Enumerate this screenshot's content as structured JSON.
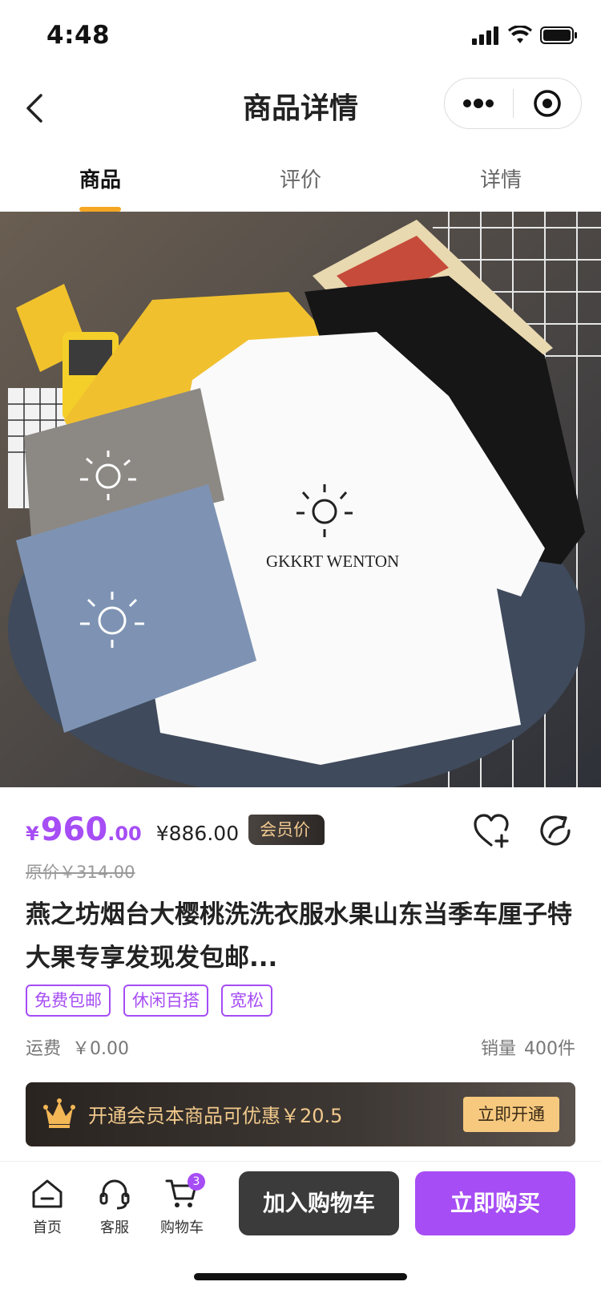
{
  "status_bar": {
    "time": "4:48"
  },
  "nav": {
    "title": "商品详情"
  },
  "tabs": [
    {
      "label": "商品",
      "active": true
    },
    {
      "label": "评价",
      "active": false
    },
    {
      "label": "详情",
      "active": false
    }
  ],
  "hero": {
    "shirt_print": "GKKRT WENTON"
  },
  "price": {
    "currency": "¥",
    "integer": "960",
    "decimal": ".00",
    "member_price": "¥886.00",
    "member_badge": "会员价",
    "original": "原价￥314.00"
  },
  "product": {
    "title": "燕之坊烟台大樱桃洗洗衣服水果山东当季车厘子特大果专享发现发包邮..."
  },
  "tags": [
    "免费包邮",
    "休闲百搭",
    "宽松"
  ],
  "freight": {
    "label": "运费",
    "value": "￥0.00"
  },
  "sales": {
    "label": "销量",
    "value": "400件"
  },
  "vip": {
    "text": "开通会员本商品可优惠￥20.5",
    "button": "立即开通"
  },
  "bottom_bar": {
    "home": "首页",
    "service": "客服",
    "cart": "购物车",
    "cart_count": "3",
    "add_to_cart": "加入购物车",
    "buy_now": "立即购买"
  },
  "colors": {
    "accent": "#a64df5",
    "tab_indicator": "#f5a623",
    "vip_gold": "#f6c97f"
  },
  "icons": [
    "signal-icon",
    "wifi-icon",
    "battery-icon",
    "back-icon",
    "more-icon",
    "target-icon",
    "heart-add-icon",
    "share-icon",
    "crown-icon",
    "home-icon",
    "headset-icon",
    "cart-icon"
  ]
}
